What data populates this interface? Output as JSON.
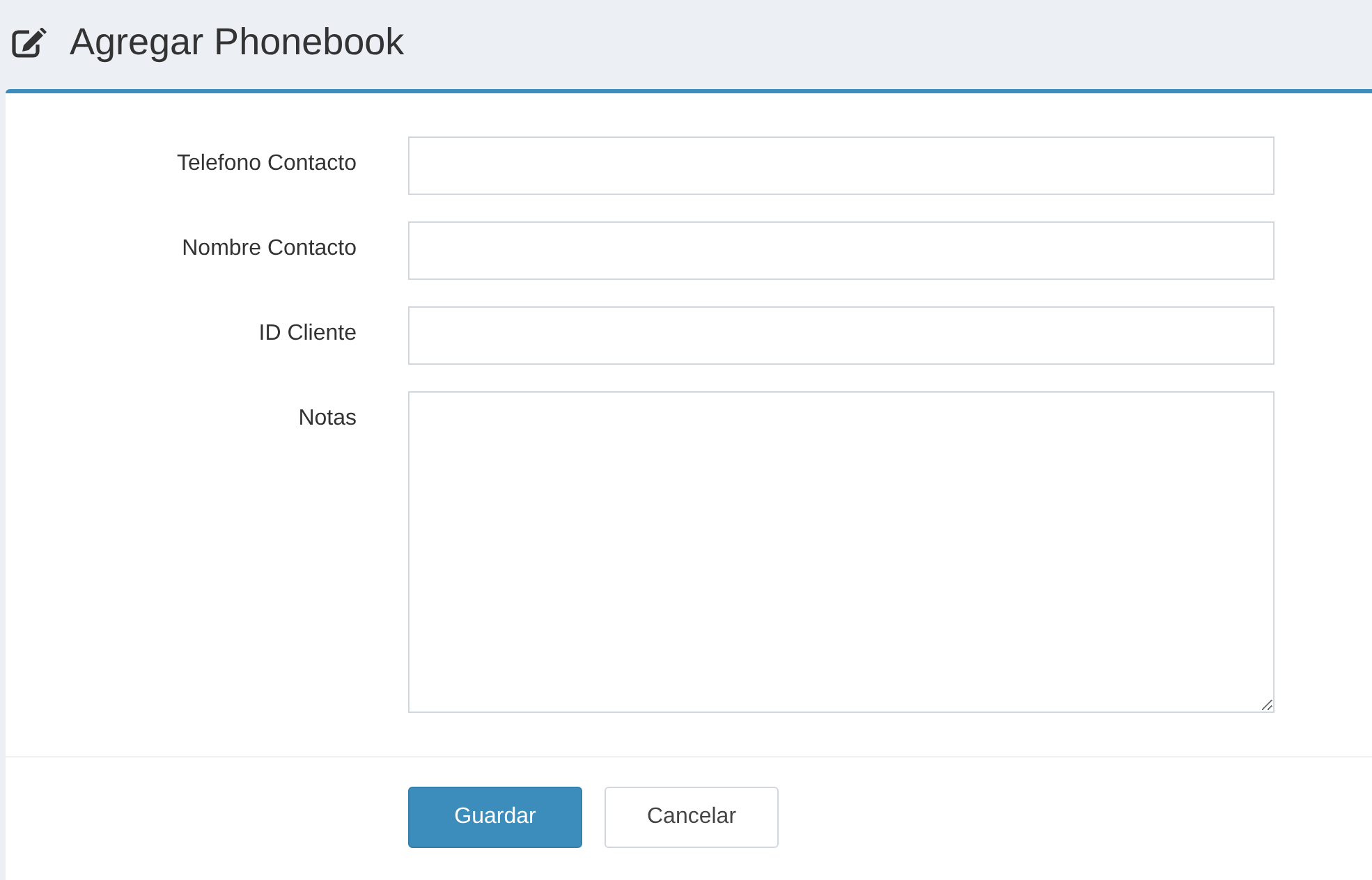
{
  "header": {
    "title": "Agregar Phonebook"
  },
  "form": {
    "fields": [
      {
        "kind": "input",
        "label": "Telefono Contacto"
      },
      {
        "kind": "input",
        "label": "Nombre Contacto"
      },
      {
        "kind": "input",
        "label": "ID Cliente"
      },
      {
        "kind": "textarea",
        "label": "Notas"
      }
    ]
  },
  "buttons": [
    {
      "kind": "primary",
      "label": "Guardar"
    },
    {
      "kind": "default",
      "label": "Cancelar"
    }
  ]
}
